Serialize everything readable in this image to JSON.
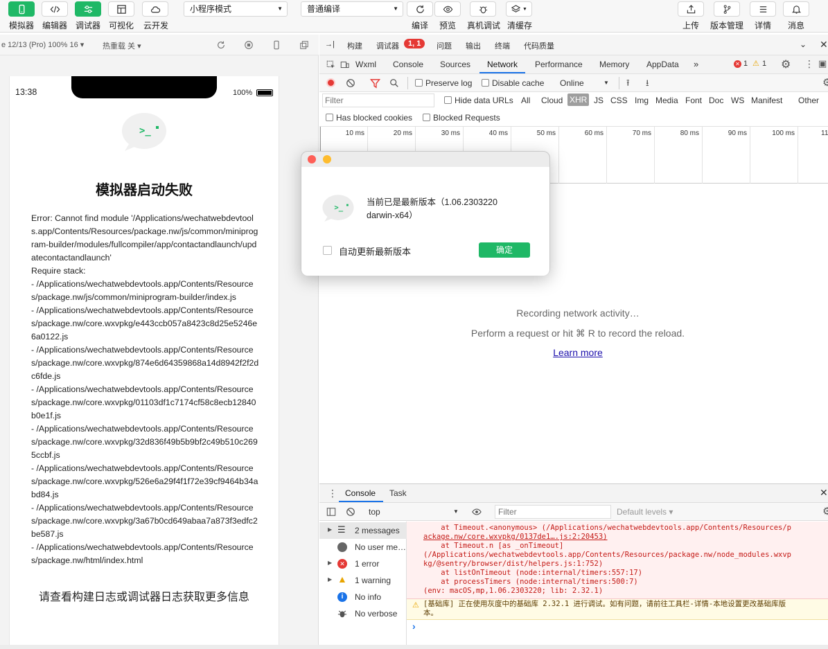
{
  "toolbar": {
    "simulator": "模拟器",
    "editor": "编辑器",
    "debugger": "调试器",
    "visual": "可视化",
    "cloud": "云开发",
    "mode_select": "小程序模式",
    "compile_select": "普通编译",
    "compile": "编译",
    "preview": "预览",
    "real_debug": "真机调试",
    "clear_cache": "清缓存",
    "upload": "上传",
    "version": "版本管理",
    "details": "详情",
    "messages": "消息"
  },
  "simbar": {
    "device": "e 12/13 (Pro) 100% 16",
    "hotreload": "热重载 关"
  },
  "phone": {
    "time": "13:38",
    "battery": "100%",
    "title": "模拟器启动失败",
    "error_lines": [
      "Error: Cannot find module '/Applications/wechatwebdevtools.app/Contents/Resources/package.nw/js/common/miniprogram-builder/modules/fullcompiler/app/contactandlaunch/updatecontactandlaunch'",
      "Require stack:",
      "- /Applications/wechatwebdevtools.app/Contents/Resources/package.nw/js/common/miniprogram-builder/index.js",
      "- /Applications/wechatwebdevtools.app/Contents/Resources/package.nw/core.wxvpkg/e443ccb057a8423c8d25e5246e6a0122.js",
      "- /Applications/wechatwebdevtools.app/Contents/Resources/package.nw/core.wxvpkg/874e6d64359868a14d8942f2f2dc6fde.js",
      "- /Applications/wechatwebdevtools.app/Contents/Resources/package.nw/core.wxvpkg/01103df1c7174cf58c8ecb12840b0e1f.js",
      "- /Applications/wechatwebdevtools.app/Contents/Resources/package.nw/core.wxvpkg/32d836f49b5b9bf2c49b510c2695ccbf.js",
      "- /Applications/wechatwebdevtools.app/Contents/Resources/package.nw/core.wxvpkg/526e6a29f4f1f72e39cf9464b34abd84.js",
      "- /Applications/wechatwebdevtools.app/Contents/Resources/package.nw/core.wxvpkg/3a67b0cd649abaa7a873f3edfc2be587.js",
      "- /Applications/wechatwebdevtools.app/Contents/Resources/package.nw/html/index.html"
    ],
    "footer": "请查看构建日志或调试器日志获取更多信息"
  },
  "devtools": {
    "top_tabs": [
      "构建",
      "调试器",
      "问题",
      "输出",
      "终端",
      "代码质量"
    ],
    "debugger_badge": "1, 1",
    "panel_tabs": [
      "Wxml",
      "Console",
      "Sources",
      "Network",
      "Performance",
      "Memory",
      "AppData"
    ],
    "error_count": "1",
    "warning_count": "1",
    "preserve_log": "Preserve log",
    "disable_cache": "Disable cache",
    "throttle": "Online",
    "filter_placeholder": "Filter",
    "hide_data_urls": "Hide data URLs",
    "type_filters": [
      "All",
      "Cloud",
      "XHR",
      "JS",
      "CSS",
      "Img",
      "Media",
      "Font",
      "Doc",
      "WS",
      "Manifest",
      "Other"
    ],
    "has_blocked_cookies": "Has blocked cookies",
    "blocked_requests": "Blocked Requests",
    "ticks": [
      "10 ms",
      "20 ms",
      "30 ms",
      "40 ms",
      "50 ms",
      "60 ms",
      "70 ms",
      "80 ms",
      "90 ms",
      "100 ms",
      "11"
    ],
    "recording": "Recording network activity…",
    "perform_hint": "Perform a request or hit ⌘ R to record the reload.",
    "learn_more": "Learn more"
  },
  "dialog": {
    "message_line1": "当前已是最新版本（1.06.2303220",
    "message_line2": "darwin-x64）",
    "auto_update": "自动更新最新版本",
    "ok": "确定"
  },
  "console": {
    "tabs": [
      "Console",
      "Task"
    ],
    "context": "top",
    "filter_placeholder": "Filter",
    "levels": "Default levels",
    "sidebar": [
      {
        "label": "2 messages",
        "icon": "list-icon",
        "arrow": true
      },
      {
        "label": "No user me…",
        "icon": "user-icon",
        "arrow": false
      },
      {
        "label": "1 error",
        "icon": "error-icon",
        "arrow": true
      },
      {
        "label": "1 warning",
        "icon": "warning-icon",
        "arrow": true
      },
      {
        "label": "No info",
        "icon": "info-icon",
        "arrow": false
      },
      {
        "label": "No verbose",
        "icon": "bug-icon",
        "arrow": false
      }
    ],
    "log": [
      "    at Timeout.<anonymous> (/Applications/wechatwebdevtools.app/Contents/Resources/p",
      "ackage.nw/core.wxvpkg/0137de1….js:2:20453)",
      "    at Timeout.n [as _onTimeout]",
      "(/Applications/wechatwebdevtools.app/Contents/Resources/package.nw/node_modules.wxvp",
      "kg/@sentry/browser/dist/helpers.js:1:752)",
      "    at listOnTimeout (node:internal/timers:557:17)",
      "    at processTimers (node:internal/timers:500:7)",
      "(env: macOS,mp,1.06.2303220; lib: 2.32.1)"
    ],
    "warning_line1": "[基础库] 正在使用灰度中的基础库 2.32.1 进行调试。如有问题，请前往工具栏-详情-本地设置更改基础库版",
    "warning_line2": "本。",
    "prompt": "›"
  },
  "colors": {
    "accent": "#1fb866",
    "error": "#c41a16",
    "warn_bg": "#fffbe5",
    "err_bg": "#fff0f0",
    "link": "#1a0dab"
  }
}
